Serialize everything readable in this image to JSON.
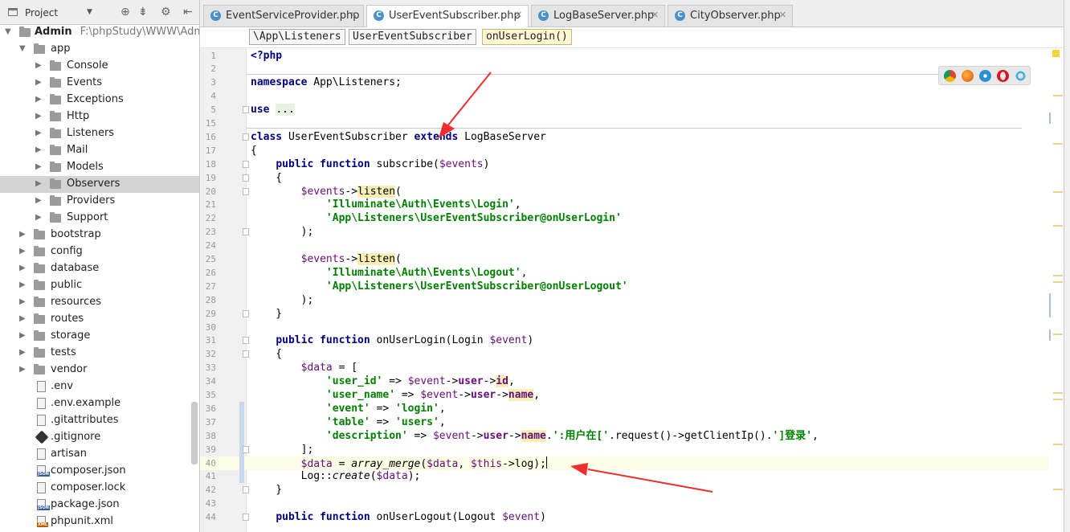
{
  "project": {
    "title": "Project",
    "root": {
      "name": "Admin",
      "path": "F:\\phpStudy\\WWW\\Admin"
    },
    "items": [
      {
        "label": "app",
        "depth": 1,
        "open": true,
        "type": "folder"
      },
      {
        "label": "Console",
        "depth": 2,
        "type": "folder"
      },
      {
        "label": "Events",
        "depth": 2,
        "type": "folder"
      },
      {
        "label": "Exceptions",
        "depth": 2,
        "type": "folder"
      },
      {
        "label": "Http",
        "depth": 2,
        "type": "folder"
      },
      {
        "label": "Listeners",
        "depth": 2,
        "type": "folder"
      },
      {
        "label": "Mail",
        "depth": 2,
        "type": "folder"
      },
      {
        "label": "Models",
        "depth": 2,
        "type": "folder"
      },
      {
        "label": "Observers",
        "depth": 2,
        "type": "folder",
        "selected": true
      },
      {
        "label": "Providers",
        "depth": 2,
        "type": "folder"
      },
      {
        "label": "Support",
        "depth": 2,
        "type": "folder"
      },
      {
        "label": "bootstrap",
        "depth": 1,
        "type": "folder"
      },
      {
        "label": "config",
        "depth": 1,
        "type": "folder"
      },
      {
        "label": "database",
        "depth": 1,
        "type": "folder"
      },
      {
        "label": "public",
        "depth": 1,
        "type": "folder"
      },
      {
        "label": "resources",
        "depth": 1,
        "type": "folder"
      },
      {
        "label": "routes",
        "depth": 1,
        "type": "folder"
      },
      {
        "label": "storage",
        "depth": 1,
        "type": "folder"
      },
      {
        "label": "tests",
        "depth": 1,
        "type": "folder"
      },
      {
        "label": "vendor",
        "depth": 1,
        "type": "folder"
      },
      {
        "label": ".env",
        "depth": 1,
        "type": "file"
      },
      {
        "label": ".env.example",
        "depth": 1,
        "type": "file"
      },
      {
        "label": ".gitattributes",
        "depth": 1,
        "type": "file"
      },
      {
        "label": ".gitignore",
        "depth": 1,
        "type": "git"
      },
      {
        "label": "artisan",
        "depth": 1,
        "type": "file"
      },
      {
        "label": "composer.json",
        "depth": 1,
        "type": "json"
      },
      {
        "label": "composer.lock",
        "depth": 1,
        "type": "file"
      },
      {
        "label": "package.json",
        "depth": 1,
        "type": "json"
      },
      {
        "label": "phpunit.xml",
        "depth": 1,
        "type": "xml"
      }
    ]
  },
  "tabs": [
    {
      "label": "EventServiceProvider.php",
      "active": false
    },
    {
      "label": "UserEventSubscriber.php",
      "active": true
    },
    {
      "label": "LogBaseServer.php",
      "active": false
    },
    {
      "label": "CityObserver.php",
      "active": false
    }
  ],
  "breadcrumb": [
    "\\App\\Listeners",
    "UserEventSubscriber",
    "onUserLogin()"
  ],
  "current_line": 40,
  "lines": [
    {
      "n": "1",
      "html": "<span class='kw'>&lt;?php</span>"
    },
    {
      "n": "2",
      "html": ""
    },
    {
      "n": "3",
      "html": "<span class='kw'>namespace</span> App\\Listeners;"
    },
    {
      "n": "4",
      "html": ""
    },
    {
      "n": "5",
      "html": "<span class='kw'>use</span> <span style='background:#e8f2e4'>...</span>"
    },
    {
      "n": "15",
      "html": ""
    },
    {
      "n": "16",
      "html": "<span class='kw'>class</span> UserEventSubscriber <span class='kw'>extends</span> LogBaseServer"
    },
    {
      "n": "17",
      "html": "{"
    },
    {
      "n": "18",
      "html": "    <span class='kw'>public function</span> subscribe(<span class='var'>$events</span>)"
    },
    {
      "n": "19",
      "html": "    {"
    },
    {
      "n": "20",
      "html": "        <span class='var'>$events</span>-><span class='fnc'>listen</span>("
    },
    {
      "n": "21",
      "html": "            <span class='str'>'Illuminate\\Auth\\Events\\Login'</span>,"
    },
    {
      "n": "22",
      "html": "            <span class='str'>'App\\Listeners\\UserEventSubscriber@onUserLogin'</span>"
    },
    {
      "n": "23",
      "html": "        );"
    },
    {
      "n": "24",
      "html": ""
    },
    {
      "n": "25",
      "html": "        <span class='var'>$events</span>-><span class='fnc'>listen</span>("
    },
    {
      "n": "26",
      "html": "            <span class='str'>'Illuminate\\Auth\\Events\\Logout'</span>,"
    },
    {
      "n": "27",
      "html": "            <span class='str'>'App\\Listeners\\UserEventSubscriber@onUserLogout'</span>"
    },
    {
      "n": "28",
      "html": "        );"
    },
    {
      "n": "29",
      "html": "    }"
    },
    {
      "n": "30",
      "html": ""
    },
    {
      "n": "31",
      "html": "    <span class='kw'>public function</span> onUserLogin(Login <span class='var'>$event</span>)"
    },
    {
      "n": "32",
      "html": "    {"
    },
    {
      "n": "33",
      "html": "        <span class='var'>$data</span> = ["
    },
    {
      "n": "34",
      "html": "            <span class='str'>'user_id'</span> => <span class='var'>$event</span>-><span class='prop'>user</span>-><span class='prop fnc'>id</span>,"
    },
    {
      "n": "35",
      "html": "            <span class='str'>'user_name'</span> => <span class='var'>$event</span>-><span class='prop'>user</span>-><span class='prop fnc'>name</span>,"
    },
    {
      "n": "36",
      "html": "            <span class='str'>'event'</span> => <span class='str'>'login'</span>,"
    },
    {
      "n": "37",
      "html": "            <span class='str'>'table'</span> => <span class='str'>'users'</span>,"
    },
    {
      "n": "38",
      "html": "            <span class='str'>'description'</span> => <span class='var'>$event</span>-><span class='prop'>user</span>-><span class='prop fnc'>name</span>.<span class='str'>':用户在['</span>.request()->getClientIp().<span class='str'>']登录'</span>,"
    },
    {
      "n": "39",
      "html": "        ];"
    },
    {
      "n": "40",
      "html": "        <span class='var'>$data</span> = <span class='ital'>array_merge</span>(<span class='var'>$data</span>, <span class='var'>$this</span>->log);<span class='caret'></span>"
    },
    {
      "n": "41",
      "html": "        Log::<span class='ital'>create</span>(<span class='var'>$data</span>);"
    },
    {
      "n": "42",
      "html": "    }"
    },
    {
      "n": "43",
      "html": ""
    },
    {
      "n": "44",
      "html": "    <span class='kw'>public function</span> onUserLogout(Logout <span class='var'>$event</span>)"
    }
  ]
}
